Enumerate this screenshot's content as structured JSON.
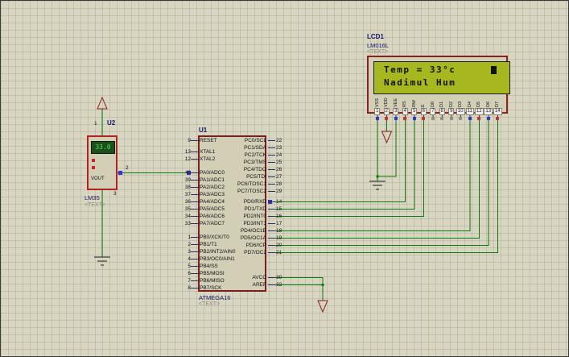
{
  "colors": {
    "wire": "#0c7a0c",
    "pin_stub": "#2a2a66",
    "component_border": "#8b2020",
    "lcd_screen": "#a7b71f",
    "state_high": "#c83232",
    "state_low": "#3535c8"
  },
  "u2": {
    "ref": "U2",
    "value": "LM35",
    "placeholder": "<TEXT>",
    "display": "33.0",
    "vout": "VOUT",
    "pin1": "1",
    "pin2": "2",
    "pin3": "3"
  },
  "u1": {
    "ref": "U1",
    "value": "ATMEGA16",
    "placeholder": "<TEXT>",
    "top_left_pins": [
      {
        "num": "9",
        "name": "RESET"
      }
    ],
    "xtal_pins": [
      {
        "num": "13",
        "name": "XTAL1"
      },
      {
        "num": "12",
        "name": "XTAL2"
      }
    ],
    "pa_pins": [
      {
        "num": "40",
        "name": "PA0/ADC0"
      },
      {
        "num": "39",
        "name": "PA1/ADC1"
      },
      {
        "num": "38",
        "name": "PA2/ADC2"
      },
      {
        "num": "37",
        "name": "PA3/ADC3"
      },
      {
        "num": "36",
        "name": "PA4/ADC4"
      },
      {
        "num": "35",
        "name": "PA5/ADC5"
      },
      {
        "num": "34",
        "name": "PA6/ADC6"
      },
      {
        "num": "33",
        "name": "PA7/ADC7"
      }
    ],
    "pb_pins": [
      {
        "num": "1",
        "name": "PB0/XCK/T0"
      },
      {
        "num": "2",
        "name": "PB1/T1"
      },
      {
        "num": "3",
        "name": "PB2/INT2/AIN0"
      },
      {
        "num": "4",
        "name": "PB3/OC0/AIN1"
      },
      {
        "num": "5",
        "name": "PB4/SS"
      },
      {
        "num": "6",
        "name": "PB5/MOSI"
      },
      {
        "num": "7",
        "name": "PB6/MISO"
      },
      {
        "num": "8",
        "name": "PB7/SCK"
      }
    ],
    "pc_pins": [
      {
        "num": "22",
        "name": "PC0/SCL"
      },
      {
        "num": "23",
        "name": "PC1/SDA"
      },
      {
        "num": "24",
        "name": "PC2/TCK"
      },
      {
        "num": "25",
        "name": "PC3/TMS"
      },
      {
        "num": "26",
        "name": "PC4/TDO"
      },
      {
        "num": "27",
        "name": "PC5/TDI"
      },
      {
        "num": "28",
        "name": "PC6/TOSC1"
      },
      {
        "num": "29",
        "name": "PC7/TOSC2"
      }
    ],
    "pd_pins": [
      {
        "num": "14",
        "name": "PD0/RXD"
      },
      {
        "num": "15",
        "name": "PD1/TXD"
      },
      {
        "num": "16",
        "name": "PD2/INT0"
      },
      {
        "num": "17",
        "name": "PD3/INT1"
      },
      {
        "num": "18",
        "name": "PD4/OC1B"
      },
      {
        "num": "19",
        "name": "PD5/OC1A"
      },
      {
        "num": "20",
        "name": "PD6/ICP"
      },
      {
        "num": "21",
        "name": "PD7/OC2"
      }
    ],
    "power_pins": [
      {
        "num": "30",
        "name": "AVCC"
      },
      {
        "num": "32",
        "name": "AREF"
      }
    ]
  },
  "lcd": {
    "ref": "LCD1",
    "value": "LM016L",
    "placeholder": "<TEXT>",
    "screen": {
      "line1": "Temp = 33°c",
      "cursor": "▮",
      "line2": "Nadimul Hum"
    },
    "pins": [
      {
        "num": "1",
        "name": "VSS",
        "state": "sq-blue"
      },
      {
        "num": "2",
        "name": "VDD",
        "state": "sq-red"
      },
      {
        "num": "3",
        "name": "VEE",
        "state": "sq-blue"
      },
      {
        "num": "4",
        "name": "RS",
        "state": "sq-red"
      },
      {
        "num": "5",
        "name": "RW",
        "state": "sq-blue"
      },
      {
        "num": "6",
        "name": "E",
        "state": "sq-red"
      },
      {
        "num": "7",
        "name": "D0",
        "state": "sq-grey"
      },
      {
        "num": "8",
        "name": "D1",
        "state": "sq-grey"
      },
      {
        "num": "9",
        "name": "D2",
        "state": "sq-grey"
      },
      {
        "num": "10",
        "name": "D3",
        "state": "sq-grey"
      },
      {
        "num": "11",
        "name": "D4",
        "state": "sq-blue"
      },
      {
        "num": "12",
        "name": "D5",
        "state": "sq-red"
      },
      {
        "num": "13",
        "name": "D6",
        "state": "sq-blue"
      },
      {
        "num": "14",
        "name": "D7",
        "state": "sq-red"
      }
    ]
  }
}
